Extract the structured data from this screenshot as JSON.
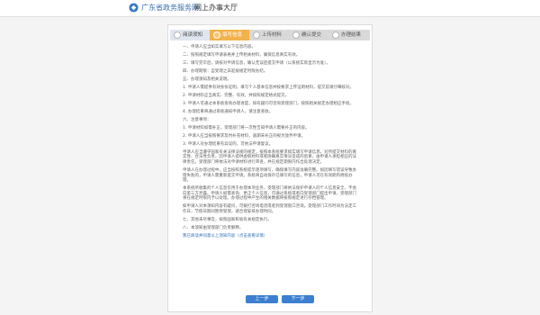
{
  "header": {
    "brand": "广东省政务服务网",
    "subtitle": "网上办事大厅"
  },
  "steps": [
    {
      "label": "阅读须知",
      "state": "done"
    },
    {
      "label": "填写信息",
      "state": "active"
    },
    {
      "label": "上传材料",
      "state": "todo"
    },
    {
      "label": "确认提交",
      "state": "todo"
    },
    {
      "label": "办理结果",
      "state": "todo"
    }
  ],
  "paragraphs": [
    "一、申请人应当如实填写以下信息内容。",
    "二、按照规定填写申请表格并上传相关材料，确保信息真实有效。",
    "三、填写完毕后，请核对申请信息，确认无误后提交申请（以系统实际显示为准）。",
    "四、办理期限：自受理之日起按规定时限办结。",
    "五、办理须知及相关说明。",
    "1. 申请人需提供有效身份证明，填写个人基本信息并按要求上传证明材料，提交前请仔细核对。",
    "2. 申请材料应当真实、完整、有效，并按照规定格式提交。",
    "3. 申请人可通过本系统查询办理进度，如有疑问可咨询受理部门，按照相关规定办理相应手续。",
    "4. 办理结果将通过系统通知申请人，请注意查收。",
    "六、注意事项：",
    "1. 申请材料如需补正，受理部门将一次性告知申请人需要补正的内容。",
    "2. 申请人应当按照要求及时补充材料，逾期未补正的视为放弃申请。",
    "3. 申请人对办理结果有异议的，可依法申请复议。",
    "申请人应当遵守国家有关法律法规的规定，按照本系统要求如实填写申请信息，对所提交材料的真实性、合法性负责。因申请人提供虚假材料或者隐瞒真实情况造成的后果，由申请人承担相应的法律责任。受理部门将依法对申请材料进行审查，并在规定期限内作出处理决定。",
    "申请人在办理过程中，应当按照系统提示逐项填写，确保填写内容准确完整。如因填写错误导致办理失败的，申请人需重新提交申请。系统将自动保存已填写的信息，申请人可在有效期内继续办理。",
    "本系统所收集的个人信息仅用于办理本项业务，受理部门将依法保护申请人的个人信息安全，不会向第三方泄露。申请人如需查询、更正个人信息，可通过系统或者向受理部门提出申请，受理部门将在规定时限内予以处理。办理过程中产生的相关数据将按照规定进行存档管理。",
    "如申请人对本须知内容有疑问，可拨打咨询电话或者到受理窗口咨询。受理部门工作时间为法定工作日，节假日期间暂停受理，请合理安排办理时间。",
    "七、其他未尽事宜，按照国家和省有关规定执行。",
    "八、本须知由受理部门负责解释。",
    "我已阅读并同意以上须知内容（点击查看详情）"
  ],
  "buttons": {
    "prev": "上一步",
    "next": "下一步"
  },
  "colors": {
    "accent": "#3c7fd0",
    "active_step": "#f2b24c"
  }
}
